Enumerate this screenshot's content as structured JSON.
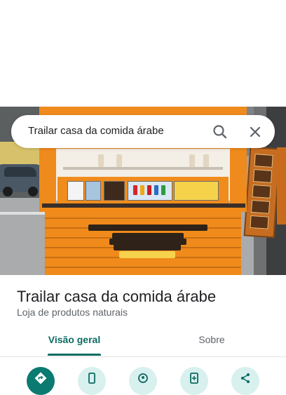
{
  "search": {
    "query": "Trailar casa da comida árabe",
    "icons": [
      "search-icon",
      "close-icon"
    ]
  },
  "place": {
    "title": "Trailar casa da comida árabe",
    "category": "Loja de produtos naturais"
  },
  "tabs": [
    {
      "label": "Visão geral",
      "active": true
    },
    {
      "label": "Sobre",
      "active": false
    }
  ],
  "actions": [
    {
      "icon": "directions-icon",
      "primary": true
    },
    {
      "icon": "phone-icon",
      "primary": false
    },
    {
      "icon": "location-pin-icon",
      "primary": false
    },
    {
      "icon": "add-to-phone-icon",
      "primary": false
    },
    {
      "icon": "share-icon",
      "primary": false
    }
  ],
  "colors": {
    "accent": "#0b6b63",
    "action_primary_bg": "#0b7a70",
    "action_secondary_bg": "#d8f0ee",
    "title_text": "#202124",
    "secondary_text": "#5f6368"
  }
}
